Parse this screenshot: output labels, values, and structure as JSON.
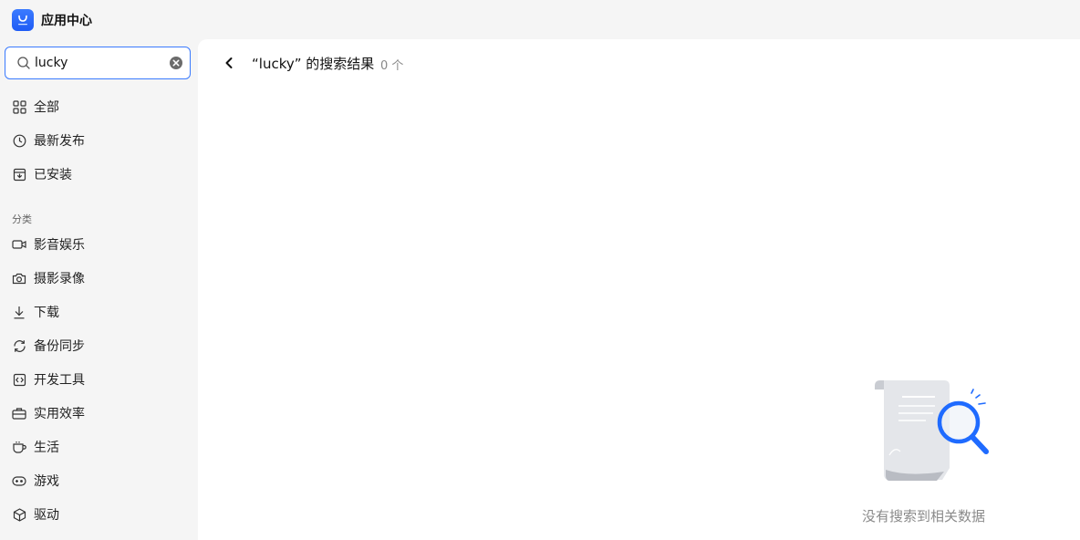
{
  "window": {
    "title": "应用中心",
    "logo_icon": "app-store-bag-icon",
    "accent": "#1f6bff"
  },
  "search": {
    "value": "lucky",
    "placeholder": ""
  },
  "sidebar": {
    "items": [
      {
        "label": "全部",
        "icon": "grid-icon"
      },
      {
        "label": "最新发布",
        "icon": "clock-icon"
      },
      {
        "label": "已安装",
        "icon": "installed-box-icon"
      }
    ],
    "category_label": "分类",
    "categories": [
      {
        "label": "影音娱乐",
        "icon": "video-camera-icon"
      },
      {
        "label": "摄影录像",
        "icon": "camera-icon"
      },
      {
        "label": "下载",
        "icon": "download-icon"
      },
      {
        "label": "备份同步",
        "icon": "sync-icon"
      },
      {
        "label": "开发工具",
        "icon": "code-icon"
      },
      {
        "label": "实用效率",
        "icon": "toolbox-icon"
      },
      {
        "label": "生活",
        "icon": "cup-icon"
      },
      {
        "label": "游戏",
        "icon": "gamepad-icon"
      },
      {
        "label": "驱动",
        "icon": "cube-icon"
      }
    ]
  },
  "main": {
    "title": "“lucky” 的搜索结果",
    "count": "0 个",
    "empty_text": "没有搜索到相关数据"
  }
}
